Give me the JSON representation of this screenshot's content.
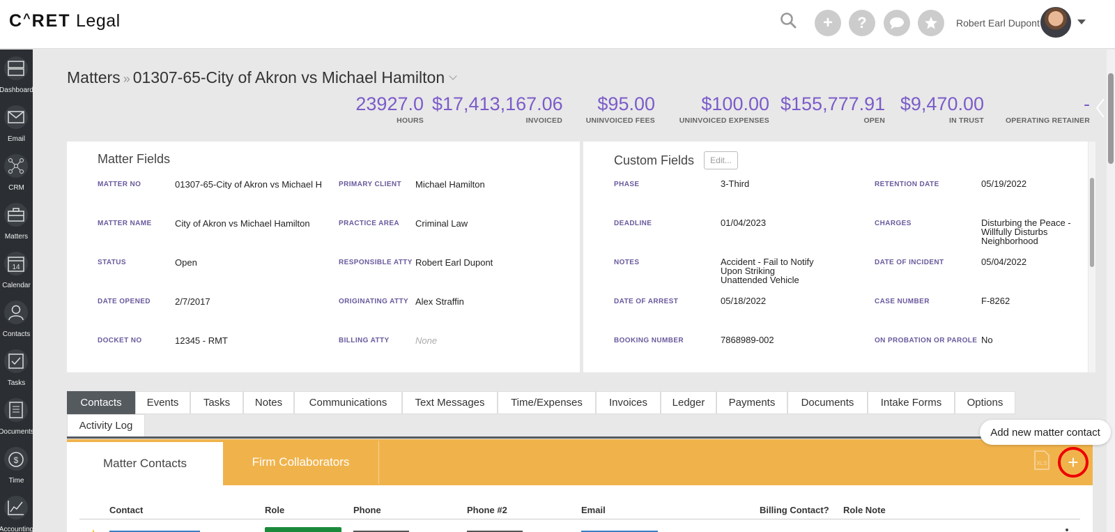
{
  "app": {
    "logo_prefix": "C",
    "logo_caret": "^",
    "logo_mid": "RET",
    "logo_suffix": " Legal"
  },
  "header": {
    "user_name": "Robert Earl Dupont",
    "buttons": [
      "search-icon",
      "plus-icon",
      "help-icon",
      "chat-icon",
      "star-icon"
    ]
  },
  "sidebar": {
    "items": [
      {
        "label": "Dashboard",
        "icon": "dashboard-icon"
      },
      {
        "label": "Email",
        "icon": "email-icon"
      },
      {
        "label": "CRM",
        "icon": "crm-icon"
      },
      {
        "label": "Matters",
        "icon": "briefcase-icon"
      },
      {
        "label": "Calendar",
        "icon": "calendar-icon",
        "day": "14"
      },
      {
        "label": "Contacts",
        "icon": "contacts-icon"
      },
      {
        "label": "Tasks",
        "icon": "tasks-icon"
      },
      {
        "label": "Documents",
        "icon": "documents-icon"
      },
      {
        "label": "Time",
        "icon": "time-icon"
      },
      {
        "label": "Accounting",
        "icon": "accounting-icon"
      }
    ]
  },
  "breadcrumb": {
    "root": "Matters",
    "separator": "»",
    "current": "01307-65-City of Akron vs Michael Hamilton"
  },
  "stats": [
    {
      "value": "23927.0",
      "caption": "HOURS"
    },
    {
      "value": "$17,413,167.06",
      "caption": "INVOICED"
    },
    {
      "value": "$95.00",
      "caption": "UNINVOICED FEES"
    },
    {
      "value": "$100.00",
      "caption": "UNINVOICED EXPENSES"
    },
    {
      "value": "$155,777.91",
      "caption": "OPEN"
    },
    {
      "value": "$9,470.00",
      "caption": "IN TRUST"
    },
    {
      "value": "-",
      "caption": "OPERATING RETAINER"
    }
  ],
  "matter_fields": {
    "title": "Matter Fields",
    "left": [
      {
        "label": "MATTER NO",
        "value": "01307-65-City of Akron vs Michael H"
      },
      {
        "label": "MATTER NAME",
        "value": "City of Akron vs Michael Hamilton"
      },
      {
        "label": "STATUS",
        "value": "Open"
      },
      {
        "label": "DATE OPENED",
        "value": "2/7/2017"
      },
      {
        "label": "DOCKET NO",
        "value": "12345 - RMT"
      }
    ],
    "right": [
      {
        "label": "PRIMARY CLIENT",
        "value": "Michael Hamilton"
      },
      {
        "label": "PRACTICE AREA",
        "value": "Criminal Law"
      },
      {
        "label": "RESPONSIBLE ATTY",
        "value": "Robert Earl Dupont"
      },
      {
        "label": "ORIGINATING ATTY",
        "value": "Alex Straffin"
      },
      {
        "label": "BILLING ATTY",
        "value": "None"
      }
    ]
  },
  "custom_fields": {
    "title": "Custom Fields",
    "edit_label": "Edit...",
    "left": [
      {
        "label": "PHASE",
        "value": "3-Third"
      },
      {
        "label": "DEADLINE",
        "value": "01/04/2023"
      },
      {
        "label": "NOTES",
        "value": "Accident - Fail to Notify\nUpon Striking\nUnattended Vehicle"
      },
      {
        "label": "DATE OF ARREST",
        "value": "05/18/2022"
      },
      {
        "label": "BOOKING NUMBER",
        "value": "7868989-002"
      }
    ],
    "right": [
      {
        "label": "RETENTION DATE",
        "value": "05/19/2022"
      },
      {
        "label": "CHARGES",
        "value": "Disturbing the Peace -\nWillfully Disturbs\nNeighborhood"
      },
      {
        "label": "DATE OF INCIDENT",
        "value": "05/04/2022"
      },
      {
        "label": "CASE NUMBER",
        "value": "F-8262"
      },
      {
        "label": "ON PROBATION OR PAROLE",
        "value": "No"
      }
    ]
  },
  "tabs": [
    "Contacts",
    "Events",
    "Tasks",
    "Notes",
    "Communications",
    "Text Messages",
    "Time/Expenses",
    "Invoices",
    "Ledger",
    "Payments",
    "Documents",
    "Intake Forms",
    "Options",
    "Activity Log"
  ],
  "active_tab": "Contacts",
  "contacts_panel": {
    "subtabs": [
      "Matter Contacts",
      "Firm Collaborators"
    ],
    "tooltip": "Add new matter contact",
    "columns": [
      "Contact",
      "Role",
      "Phone",
      "Phone #2",
      "Email",
      "Billing Contact?",
      "Role Note"
    ]
  },
  "colors": {
    "accent_purple": "#7b5cc9",
    "orange": "#f0b34c",
    "sidebar_bg": "#2b2f33",
    "highlight_red": "#ee0000"
  }
}
